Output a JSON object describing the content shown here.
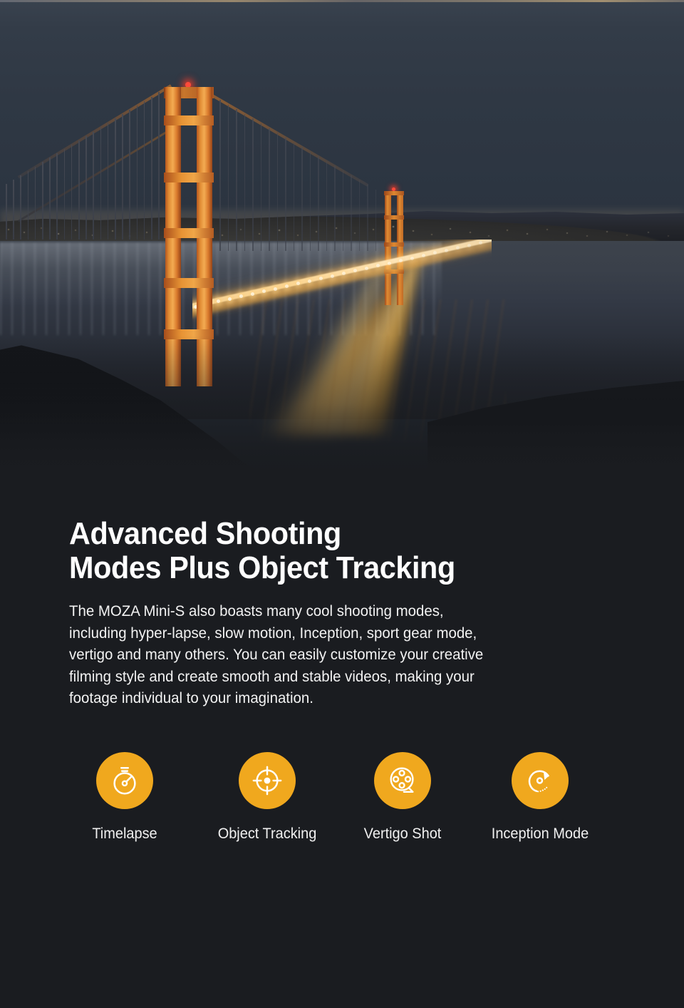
{
  "hero": {
    "image_name": "golden-gate-bridge-night-photo",
    "description": "Golden Gate Bridge at night with city lights and golden light reflections on the water"
  },
  "section": {
    "heading": "Advanced Shooting\nModes Plus Object Tracking",
    "body": "The MOZA Mini-S also boasts many cool shooting modes,\nincluding hyper-lapse, slow motion, Inception, sport gear mode,\n vertigo and many others. You can easily customize your creative\nfilming style and create smooth and stable videos, making your\nfootage individual to your imagination."
  },
  "features": [
    {
      "label": "Timelapse",
      "icon": "stopwatch-icon"
    },
    {
      "label": "Object Tracking",
      "icon": "crosshair-target-icon"
    },
    {
      "label": "Vertigo Shot",
      "icon": "film-reel-icon"
    },
    {
      "label": "Inception Mode",
      "icon": "rotate-arrow-icon"
    }
  ],
  "colors": {
    "background": "#1a1c20",
    "accent_orange": "#f0a81e",
    "text_primary": "#ffffff",
    "text_body": "#f2f2f2"
  }
}
